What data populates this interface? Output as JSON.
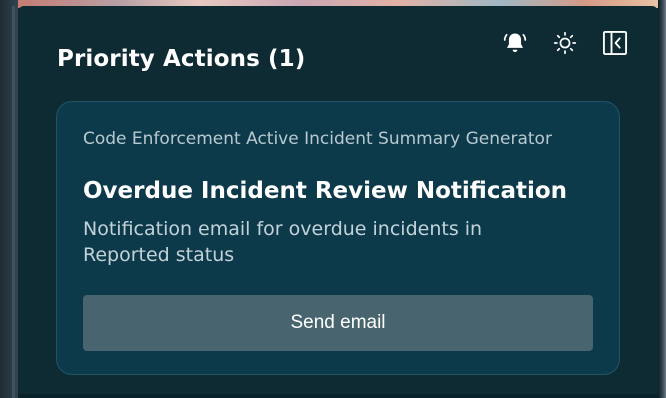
{
  "panel": {
    "title": "Priority Actions (1)",
    "icons": [
      "bell-icon",
      "sun-icon",
      "collapse-panel-icon"
    ]
  },
  "card": {
    "source": "Code Enforcement Active Incident Summary Generator",
    "title": "Overdue Incident Review Notification",
    "description": "Notification email for overdue incidents in Reported status",
    "button_label": "Send email"
  },
  "colors": {
    "panel_bg": "#0e2a33",
    "card_bg": "#0c3a4b",
    "button_bg": "#48656f",
    "text_primary": "#ffffff",
    "text_secondary": "#c3d2d8"
  }
}
